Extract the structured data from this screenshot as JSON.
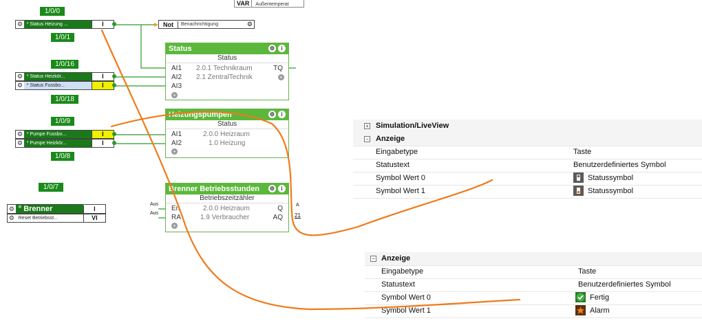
{
  "top_fragment": {
    "var_label": "VAR",
    "var_text": "Außentemperat"
  },
  "groups": {
    "g1": "1/0/0",
    "g2": "1/0/1",
    "g3": "1/0/16",
    "g4": "1/0/18",
    "g5": "1/0/9",
    "g6": "1/0/8",
    "g7": "1/0/7"
  },
  "inputs": {
    "status_heizung": {
      "name": "* Status Heizung ...",
      "value": "I"
    },
    "status_heizkoerper": {
      "name": "* Status Heizkör...",
      "value": "I"
    },
    "status_fussboden": {
      "name": "* Status Fussbo...",
      "value": "I"
    },
    "pumpe_fussboden": {
      "name": "* Pumpe Fussbo...",
      "value": "I"
    },
    "pumpe_heizkoerper": {
      "name": "* Pumpe Heizkör...",
      "value": "I"
    },
    "brenner": {
      "name": "° Brenner",
      "value": "I",
      "out": "Aus"
    },
    "reset": {
      "name": "Reset Betriebsst...",
      "value": "VI",
      "out": "Aus"
    }
  },
  "not_block": {
    "label": "Not",
    "text": "Benachrichtigung"
  },
  "nodes": {
    "status": {
      "title": "Status",
      "subtitle": "Status",
      "ports": [
        "AI1",
        "AI2",
        "AI3"
      ],
      "values": [
        "2.0.1 Technikraum",
        "2.1 ZentralTechnik",
        ""
      ],
      "out": "TQ"
    },
    "pumpen": {
      "title": "Heizungspumpen",
      "subtitle": "Status",
      "ports": [
        "AI1",
        "AI2"
      ],
      "values": [
        "2.0.0 Heizraum",
        "1.0 Heizung"
      ]
    },
    "brenner": {
      "title": "Brenner Betriebsstunden",
      "subtitle": "Betriebszeitzähler",
      "ports": [
        "En",
        "RA"
      ],
      "values": [
        "2.0.0 Heizraum",
        "1.9 Verbraucher"
      ],
      "outs": [
        "Q",
        "AQ"
      ],
      "out_label": "A",
      "out_value": "21"
    }
  },
  "panel1": {
    "section1": "Simulation/LiveView",
    "section2": "Anzeige",
    "rows": [
      {
        "key": "Eingabetype",
        "value": "Taste"
      },
      {
        "key": "Statustext",
        "value": "Benutzerdefiniertes Symbol"
      },
      {
        "key": "Symbol Wert 0",
        "value": "Statussymbol",
        "icon": "status-symbol-off-icon"
      },
      {
        "key": "Symbol Wert 1",
        "value": "Statussymbol",
        "icon": "status-symbol-on-icon"
      }
    ]
  },
  "panel2": {
    "section": "Anzeige",
    "rows": [
      {
        "key": "Eingabetype",
        "value": "Taste"
      },
      {
        "key": "Statustext",
        "value": "Benutzerdefiniertes Symbol"
      },
      {
        "key": "Symbol Wert 0",
        "value": "Fertig",
        "icon": "check-icon"
      },
      {
        "key": "Symbol Wert 1",
        "value": "Alarm",
        "icon": "alarm-icon"
      }
    ]
  },
  "colors": {
    "accent_green": "#5cb83c",
    "annotation_orange": "#f07a1a",
    "yellow_value": "#f0f000"
  }
}
